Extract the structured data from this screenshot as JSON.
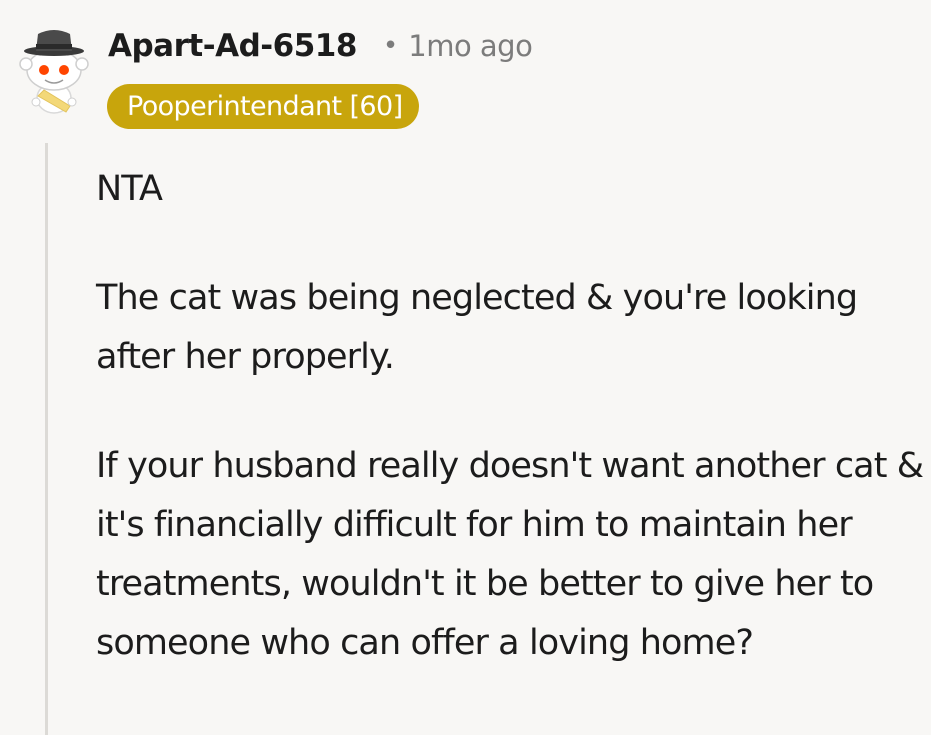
{
  "comment": {
    "avatar_icon": "snoo-avatar-with-hat-icon",
    "username": "Apart-Ad-6518",
    "separator": "•",
    "timestamp": "1mo ago",
    "flair": "Pooperintendant [60]",
    "paragraphs": [
      "NTA",
      "The cat was being neglected & you're looking after her properly.",
      "If your husband really doesn't want another cat & it's financially difficult for him to maintain her treatments, wouldn't it be better to give her to someone who can offer a loving home?"
    ]
  },
  "colors": {
    "background": "#f8f7f5",
    "text": "#1c1c1c",
    "meta": "#7c7c7c",
    "flair_bg": "#c8a50c",
    "flair_text": "#ffffff",
    "thread_line": "#dcdad6"
  }
}
